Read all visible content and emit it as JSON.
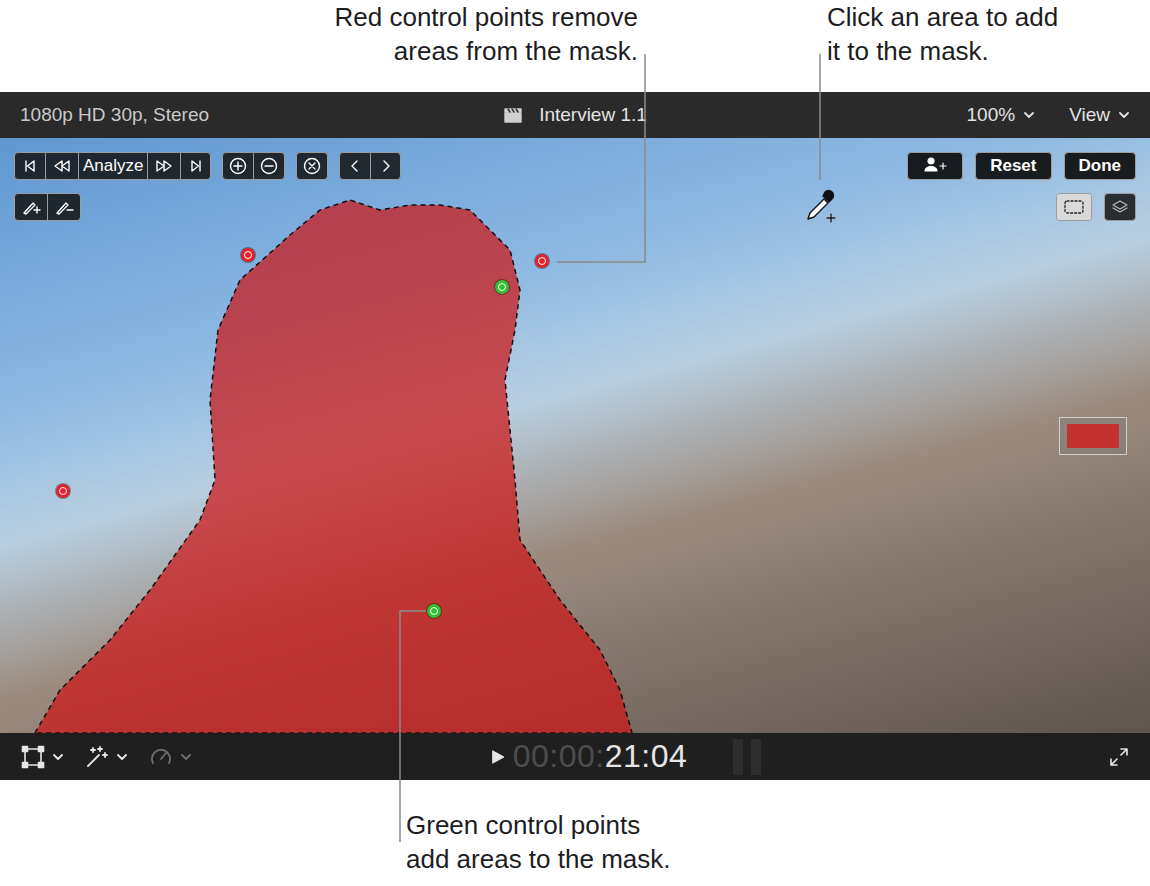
{
  "callouts": {
    "remove": {
      "lines": [
        "Red control points remove",
        "areas from the mask."
      ]
    },
    "add_area": {
      "lines": [
        "Click an area to add",
        "it to the mask."
      ]
    },
    "add": {
      "lines": [
        "Green control points",
        "add areas to the mask."
      ]
    }
  },
  "viewer": {
    "format": "1080p HD 30p, Stereo",
    "title": "Interview 1.1",
    "zoom": "100%",
    "view": "View"
  },
  "toolbar": {
    "analyze": "Analyze",
    "reset": "Reset",
    "done": "Done"
  },
  "view_modes": [
    {
      "selected": true
    },
    {
      "selected": false
    }
  ],
  "control_points": [
    {
      "kind": "remove",
      "color": "#e5202a"
    },
    {
      "kind": "remove",
      "color": "#e5202a"
    },
    {
      "kind": "remove",
      "color": "#e5202a"
    },
    {
      "kind": "add",
      "color": "#2fc12f"
    },
    {
      "kind": "add",
      "color": "#2fc12f"
    }
  ],
  "tools": [
    {
      "disabled": false
    },
    {
      "disabled": false
    },
    {
      "disabled": true
    }
  ],
  "timecode": {
    "elapsed": "00:00:",
    "current": "21:04"
  }
}
